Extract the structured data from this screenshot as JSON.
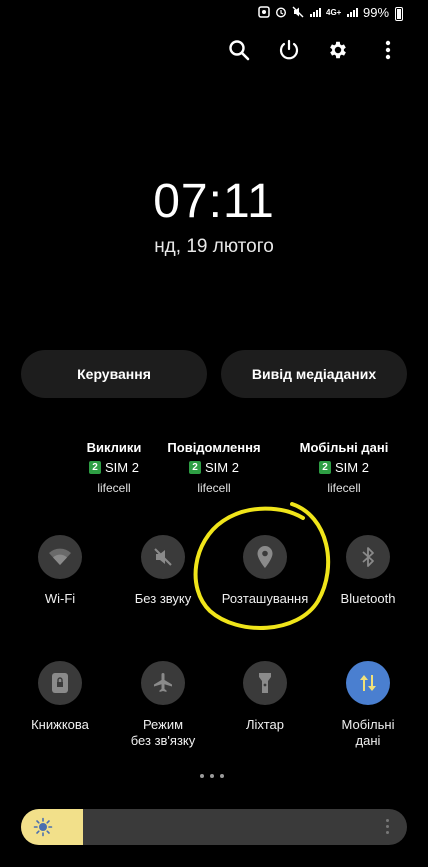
{
  "status_bar": {
    "battery_percent": "99%",
    "network_type": "4G+",
    "icons": [
      "screenshot-icon",
      "alarm-icon",
      "mute-icon",
      "wifi-calling-icon",
      "signal-icon",
      "signal-icon",
      "battery-icon"
    ]
  },
  "top_actions": [
    "search-icon",
    "power-icon",
    "settings-icon",
    "more-icon"
  ],
  "clock": {
    "time": "07:11",
    "date": "нд, 19 лютого"
  },
  "buttons": {
    "control": "Керування",
    "media_output": "Вивід медіаданих"
  },
  "sim_info": [
    {
      "title": "Виклики",
      "sim_number": "2",
      "sim_label": "SIM 2",
      "carrier": "lifecell"
    },
    {
      "title": "Повідомлення",
      "sim_number": "2",
      "sim_label": "SIM 2",
      "carrier": "lifecell"
    },
    {
      "title": "Мобільні дані",
      "sim_number": "2",
      "sim_label": "SIM 2",
      "carrier": "lifecell"
    }
  ],
  "tiles": [
    {
      "label": "Wi-Fi",
      "icon": "wifi-icon",
      "active": false
    },
    {
      "label": "Без звуку",
      "icon": "mute-icon",
      "active": false
    },
    {
      "label": "Розташування",
      "icon": "location-icon",
      "active": false
    },
    {
      "label": "Bluetooth",
      "icon": "bluetooth-icon",
      "active": false
    },
    {
      "label": "Книжкова",
      "icon": "portrait-lock-icon",
      "active": false
    },
    {
      "label_line1": "Режим",
      "label_line2": "без зв'язку",
      "icon": "airplane-icon",
      "active": false
    },
    {
      "label": "Ліхтар",
      "icon": "flashlight-icon",
      "active": false
    },
    {
      "label_line1": "Мобільні",
      "label_line2": "дані",
      "icon": "mobile-data-icon",
      "active": true
    }
  ],
  "colors": {
    "accent_active": "#4a7fd0",
    "annotation": "#f0e51a",
    "slider_fill": "#f2e08a",
    "sim_badge": "#2e9e44"
  },
  "brightness": {
    "level": 0.16
  },
  "annotation": {
    "target": "Розташування"
  }
}
